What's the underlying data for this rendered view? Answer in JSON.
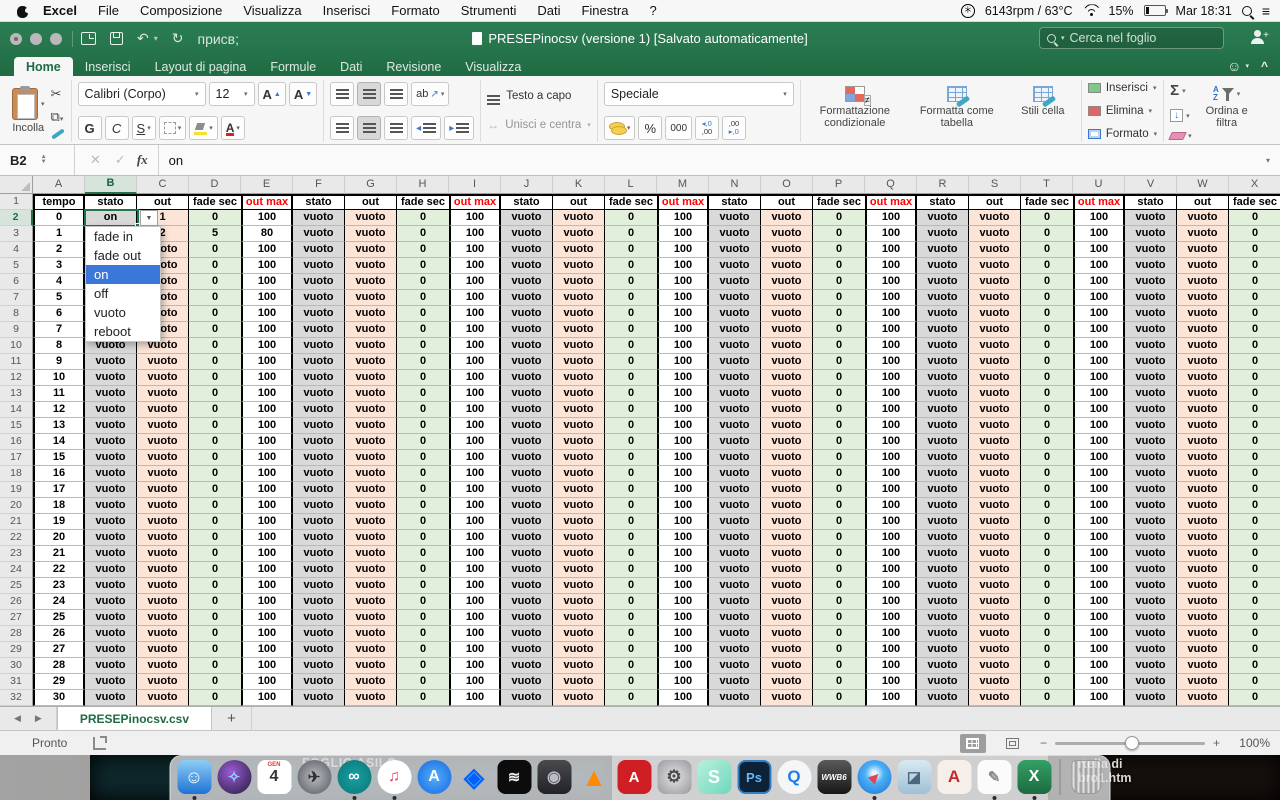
{
  "menubar": {
    "items": [
      "Excel",
      "File",
      "Composizione",
      "Visualizza",
      "Inserisci",
      "Formato",
      "Strumenti",
      "Dati",
      "Finestra",
      "?"
    ],
    "fan_text": "6143rpm / 63°C",
    "battery": "15%",
    "clock": "Mar 18:31"
  },
  "titlebar": {
    "title": "PRESEPinocsv (versione 1) [Salvato automaticamente]",
    "search_placeholder": "Cerca nel foglio"
  },
  "ribbon": {
    "tabs": [
      "Home",
      "Inserisci",
      "Layout di pagina",
      "Formule",
      "Dati",
      "Revisione",
      "Visualizza"
    ],
    "active_tab": "Home",
    "paste_label": "Incolla",
    "font_name": "Calibri (Corpo)",
    "font_size": "12",
    "grow_font": "A",
    "shrink_font": "A",
    "bold": "G",
    "italic": "C",
    "underline": "S",
    "orient": "ab",
    "orient_arrow": "↗",
    "wrap_label": "Testo a capo",
    "merge_label": "Unisci e centra",
    "number_format": "Speciale",
    "percent": "%",
    "thousands": "000",
    "dec1_top": "◂,0",
    "dec1_bot": ",00",
    "dec2_top": ",00",
    "dec2_bot": "▸,0",
    "cond_format": "Formattazione condizionale",
    "format_table": "Formatta come tabella",
    "cell_styles": "Stili cella",
    "insert_label": "Inserisci",
    "delete_label": "Elimina",
    "format_label": "Formato",
    "autosum": "Σ",
    "filldown": "↓",
    "az_a": "A",
    "az_z": "Z",
    "sort_filter": "Ordina e filtra"
  },
  "formula_bar": {
    "cell_ref": "B2",
    "fx_label": "fx",
    "value": "on",
    "cancel": "✕",
    "confirm": "✓"
  },
  "grid": {
    "selected_col": "B",
    "selected_row": 2,
    "column_letters": [
      "A",
      "B",
      "C",
      "D",
      "E",
      "F",
      "G",
      "H",
      "I",
      "J",
      "K",
      "L",
      "M",
      "N",
      "O",
      "P",
      "Q",
      "R",
      "S",
      "T",
      "U",
      "V",
      "W",
      "X"
    ],
    "header_row": [
      "tempo",
      "stato",
      "out",
      "fade sec",
      "out max",
      "stato",
      "out",
      "fade sec",
      "out max",
      "stato",
      "out",
      "fade sec",
      "out max",
      "stato",
      "out",
      "fade sec",
      "out max",
      "stato",
      "out",
      "fade sec",
      "out max",
      "stato",
      "out",
      "fade sec"
    ],
    "rows": [
      [
        "0",
        "on",
        "1",
        "0",
        "100",
        "vuoto",
        "vuoto",
        "0",
        "100",
        "vuoto",
        "vuoto",
        "0",
        "100",
        "vuoto",
        "vuoto",
        "0",
        "100",
        "vuoto",
        "vuoto",
        "0",
        "100",
        "vuoto",
        "vuoto",
        "0"
      ],
      [
        "1",
        "",
        "2",
        "5",
        "80",
        "vuoto",
        "vuoto",
        "0",
        "100",
        "vuoto",
        "vuoto",
        "0",
        "100",
        "vuoto",
        "vuoto",
        "0",
        "100",
        "vuoto",
        "vuoto",
        "0",
        "100",
        "vuoto",
        "vuoto",
        "0"
      ],
      [
        "2",
        "vuoto",
        "vuoto",
        "0",
        "100",
        "vuoto",
        "vuoto",
        "0",
        "100",
        "vuoto",
        "vuoto",
        "0",
        "100",
        "vuoto",
        "vuoto",
        "0",
        "100",
        "vuoto",
        "vuoto",
        "0",
        "100",
        "vuoto",
        "vuoto",
        "0"
      ],
      [
        "3",
        "vuoto",
        "vuoto",
        "0",
        "100",
        "vuoto",
        "vuoto",
        "0",
        "100",
        "vuoto",
        "vuoto",
        "0",
        "100",
        "vuoto",
        "vuoto",
        "0",
        "100",
        "vuoto",
        "vuoto",
        "0",
        "100",
        "vuoto",
        "vuoto",
        "0"
      ],
      [
        "4",
        "vuoto",
        "vuoto",
        "0",
        "100",
        "vuoto",
        "vuoto",
        "0",
        "100",
        "vuoto",
        "vuoto",
        "0",
        "100",
        "vuoto",
        "vuoto",
        "0",
        "100",
        "vuoto",
        "vuoto",
        "0",
        "100",
        "vuoto",
        "vuoto",
        "0"
      ],
      [
        "5",
        "vuoto",
        "vuoto",
        "0",
        "100",
        "vuoto",
        "vuoto",
        "0",
        "100",
        "vuoto",
        "vuoto",
        "0",
        "100",
        "vuoto",
        "vuoto",
        "0",
        "100",
        "vuoto",
        "vuoto",
        "0",
        "100",
        "vuoto",
        "vuoto",
        "0"
      ],
      [
        "6",
        "vuoto",
        "vuoto",
        "0",
        "100",
        "vuoto",
        "vuoto",
        "0",
        "100",
        "vuoto",
        "vuoto",
        "0",
        "100",
        "vuoto",
        "vuoto",
        "0",
        "100",
        "vuoto",
        "vuoto",
        "0",
        "100",
        "vuoto",
        "vuoto",
        "0"
      ],
      [
        "7",
        "vuoto",
        "vuoto",
        "0",
        "100",
        "vuoto",
        "vuoto",
        "0",
        "100",
        "vuoto",
        "vuoto",
        "0",
        "100",
        "vuoto",
        "vuoto",
        "0",
        "100",
        "vuoto",
        "vuoto",
        "0",
        "100",
        "vuoto",
        "vuoto",
        "0"
      ],
      [
        "8",
        "vuoto",
        "vuoto",
        "0",
        "100",
        "vuoto",
        "vuoto",
        "0",
        "100",
        "vuoto",
        "vuoto",
        "0",
        "100",
        "vuoto",
        "vuoto",
        "0",
        "100",
        "vuoto",
        "vuoto",
        "0",
        "100",
        "vuoto",
        "vuoto",
        "0"
      ],
      [
        "9",
        "vuoto",
        "vuoto",
        "0",
        "100",
        "vuoto",
        "vuoto",
        "0",
        "100",
        "vuoto",
        "vuoto",
        "0",
        "100",
        "vuoto",
        "vuoto",
        "0",
        "100",
        "vuoto",
        "vuoto",
        "0",
        "100",
        "vuoto",
        "vuoto",
        "0"
      ],
      [
        "10",
        "vuoto",
        "vuoto",
        "0",
        "100",
        "vuoto",
        "vuoto",
        "0",
        "100",
        "vuoto",
        "vuoto",
        "0",
        "100",
        "vuoto",
        "vuoto",
        "0",
        "100",
        "vuoto",
        "vuoto",
        "0",
        "100",
        "vuoto",
        "vuoto",
        "0"
      ],
      [
        "11",
        "vuoto",
        "vuoto",
        "0",
        "100",
        "vuoto",
        "vuoto",
        "0",
        "100",
        "vuoto",
        "vuoto",
        "0",
        "100",
        "vuoto",
        "vuoto",
        "0",
        "100",
        "vuoto",
        "vuoto",
        "0",
        "100",
        "vuoto",
        "vuoto",
        "0"
      ],
      [
        "12",
        "vuoto",
        "vuoto",
        "0",
        "100",
        "vuoto",
        "vuoto",
        "0",
        "100",
        "vuoto",
        "vuoto",
        "0",
        "100",
        "vuoto",
        "vuoto",
        "0",
        "100",
        "vuoto",
        "vuoto",
        "0",
        "100",
        "vuoto",
        "vuoto",
        "0"
      ],
      [
        "13",
        "vuoto",
        "vuoto",
        "0",
        "100",
        "vuoto",
        "vuoto",
        "0",
        "100",
        "vuoto",
        "vuoto",
        "0",
        "100",
        "vuoto",
        "vuoto",
        "0",
        "100",
        "vuoto",
        "vuoto",
        "0",
        "100",
        "vuoto",
        "vuoto",
        "0"
      ],
      [
        "14",
        "vuoto",
        "vuoto",
        "0",
        "100",
        "vuoto",
        "vuoto",
        "0",
        "100",
        "vuoto",
        "vuoto",
        "0",
        "100",
        "vuoto",
        "vuoto",
        "0",
        "100",
        "vuoto",
        "vuoto",
        "0",
        "100",
        "vuoto",
        "vuoto",
        "0"
      ],
      [
        "15",
        "vuoto",
        "vuoto",
        "0",
        "100",
        "vuoto",
        "vuoto",
        "0",
        "100",
        "vuoto",
        "vuoto",
        "0",
        "100",
        "vuoto",
        "vuoto",
        "0",
        "100",
        "vuoto",
        "vuoto",
        "0",
        "100",
        "vuoto",
        "vuoto",
        "0"
      ],
      [
        "16",
        "vuoto",
        "vuoto",
        "0",
        "100",
        "vuoto",
        "vuoto",
        "0",
        "100",
        "vuoto",
        "vuoto",
        "0",
        "100",
        "vuoto",
        "vuoto",
        "0",
        "100",
        "vuoto",
        "vuoto",
        "0",
        "100",
        "vuoto",
        "vuoto",
        "0"
      ],
      [
        "17",
        "vuoto",
        "vuoto",
        "0",
        "100",
        "vuoto",
        "vuoto",
        "0",
        "100",
        "vuoto",
        "vuoto",
        "0",
        "100",
        "vuoto",
        "vuoto",
        "0",
        "100",
        "vuoto",
        "vuoto",
        "0",
        "100",
        "vuoto",
        "vuoto",
        "0"
      ],
      [
        "18",
        "vuoto",
        "vuoto",
        "0",
        "100",
        "vuoto",
        "vuoto",
        "0",
        "100",
        "vuoto",
        "vuoto",
        "0",
        "100",
        "vuoto",
        "vuoto",
        "0",
        "100",
        "vuoto",
        "vuoto",
        "0",
        "100",
        "vuoto",
        "vuoto",
        "0"
      ],
      [
        "19",
        "vuoto",
        "vuoto",
        "0",
        "100",
        "vuoto",
        "vuoto",
        "0",
        "100",
        "vuoto",
        "vuoto",
        "0",
        "100",
        "vuoto",
        "vuoto",
        "0",
        "100",
        "vuoto",
        "vuoto",
        "0",
        "100",
        "vuoto",
        "vuoto",
        "0"
      ],
      [
        "20",
        "vuoto",
        "vuoto",
        "0",
        "100",
        "vuoto",
        "vuoto",
        "0",
        "100",
        "vuoto",
        "vuoto",
        "0",
        "100",
        "vuoto",
        "vuoto",
        "0",
        "100",
        "vuoto",
        "vuoto",
        "0",
        "100",
        "vuoto",
        "vuoto",
        "0"
      ],
      [
        "21",
        "vuoto",
        "vuoto",
        "0",
        "100",
        "vuoto",
        "vuoto",
        "0",
        "100",
        "vuoto",
        "vuoto",
        "0",
        "100",
        "vuoto",
        "vuoto",
        "0",
        "100",
        "vuoto",
        "vuoto",
        "0",
        "100",
        "vuoto",
        "vuoto",
        "0"
      ],
      [
        "22",
        "vuoto",
        "vuoto",
        "0",
        "100",
        "vuoto",
        "vuoto",
        "0",
        "100",
        "vuoto",
        "vuoto",
        "0",
        "100",
        "vuoto",
        "vuoto",
        "0",
        "100",
        "vuoto",
        "vuoto",
        "0",
        "100",
        "vuoto",
        "vuoto",
        "0"
      ],
      [
        "23",
        "vuoto",
        "vuoto",
        "0",
        "100",
        "vuoto",
        "vuoto",
        "0",
        "100",
        "vuoto",
        "vuoto",
        "0",
        "100",
        "vuoto",
        "vuoto",
        "0",
        "100",
        "vuoto",
        "vuoto",
        "0",
        "100",
        "vuoto",
        "vuoto",
        "0"
      ],
      [
        "24",
        "vuoto",
        "vuoto",
        "0",
        "100",
        "vuoto",
        "vuoto",
        "0",
        "100",
        "vuoto",
        "vuoto",
        "0",
        "100",
        "vuoto",
        "vuoto",
        "0",
        "100",
        "vuoto",
        "vuoto",
        "0",
        "100",
        "vuoto",
        "vuoto",
        "0"
      ],
      [
        "25",
        "vuoto",
        "vuoto",
        "0",
        "100",
        "vuoto",
        "vuoto",
        "0",
        "100",
        "vuoto",
        "vuoto",
        "0",
        "100",
        "vuoto",
        "vuoto",
        "0",
        "100",
        "vuoto",
        "vuoto",
        "0",
        "100",
        "vuoto",
        "vuoto",
        "0"
      ],
      [
        "26",
        "vuoto",
        "vuoto",
        "0",
        "100",
        "vuoto",
        "vuoto",
        "0",
        "100",
        "vuoto",
        "vuoto",
        "0",
        "100",
        "vuoto",
        "vuoto",
        "0",
        "100",
        "vuoto",
        "vuoto",
        "0",
        "100",
        "vuoto",
        "vuoto",
        "0"
      ],
      [
        "27",
        "vuoto",
        "vuoto",
        "0",
        "100",
        "vuoto",
        "vuoto",
        "0",
        "100",
        "vuoto",
        "vuoto",
        "0",
        "100",
        "vuoto",
        "vuoto",
        "0",
        "100",
        "vuoto",
        "vuoto",
        "0",
        "100",
        "vuoto",
        "vuoto",
        "0"
      ],
      [
        "28",
        "vuoto",
        "vuoto",
        "0",
        "100",
        "vuoto",
        "vuoto",
        "0",
        "100",
        "vuoto",
        "vuoto",
        "0",
        "100",
        "vuoto",
        "vuoto",
        "0",
        "100",
        "vuoto",
        "vuoto",
        "0",
        "100",
        "vuoto",
        "vuoto",
        "0"
      ],
      [
        "29",
        "vuoto",
        "vuoto",
        "0",
        "100",
        "vuoto",
        "vuoto",
        "0",
        "100",
        "vuoto",
        "vuoto",
        "0",
        "100",
        "vuoto",
        "vuoto",
        "0",
        "100",
        "vuoto",
        "vuoto",
        "0",
        "100",
        "vuoto",
        "vuoto",
        "0"
      ],
      [
        "30",
        "vuoto",
        "vuoto",
        "0",
        "100",
        "vuoto",
        "vuoto",
        "0",
        "100",
        "vuoto",
        "vuoto",
        "0",
        "100",
        "vuoto",
        "vuoto",
        "0",
        "100",
        "vuoto",
        "vuoto",
        "0",
        "100",
        "vuoto",
        "vuoto",
        "0"
      ]
    ]
  },
  "dropdown": {
    "options": [
      "fade in",
      "fade out",
      "on",
      "off",
      "vuoto",
      "reboot"
    ],
    "selected_index": 2
  },
  "sheetbar": {
    "active_tab": "PRESEPinocsv.csv",
    "add_label": "+"
  },
  "statusbar": {
    "ready": "Pronto",
    "zoom_pct": "100%",
    "minus": "−",
    "plus": "+"
  },
  "desktop": {
    "left_text": "FOGLIO ASILO",
    "right_line1": "rtella di",
    "right_line2": "bro1.htm"
  },
  "dock": {
    "items": [
      {
        "name": "finder",
        "glyph": "☺",
        "fg": "#ffffff",
        "bg": "linear-gradient(180deg,#8ecdf7,#1e72d4)",
        "round": false,
        "dot": true,
        "size": 18
      },
      {
        "name": "siri",
        "glyph": "✧",
        "fg": "#8fd0ff",
        "bg": "radial-gradient(circle at 40% 35%, #9a5bd4, #241b3a)",
        "round": true,
        "dot": false,
        "size": 15
      },
      {
        "name": "calendar",
        "glyph": "4",
        "fg": "#333333",
        "bg": "#ffffff",
        "round": false,
        "dot": false,
        "size": 16,
        "top": "GEN",
        "top_color": "#e03c31"
      },
      {
        "name": "launchpad",
        "glyph": "✈",
        "fg": "#2e3033",
        "bg": "radial-gradient(circle,#b9bdc2,#53565c)",
        "round": true,
        "dot": false,
        "size": 15
      },
      {
        "name": "arduino",
        "glyph": "∞",
        "fg": "#ffffff",
        "bg": "radial-gradient(circle,#17a0a3,#0c7476)",
        "round": true,
        "dot": true,
        "size": 16
      },
      {
        "name": "itunes",
        "glyph": "♫",
        "fg": "#f0426b",
        "bg": "#ffffff",
        "round": true,
        "dot": true,
        "size": 16
      },
      {
        "name": "app-store",
        "glyph": "A",
        "fg": "#ffffff",
        "bg": "radial-gradient(circle,#53aefc,#1667de)",
        "round": true,
        "dot": false,
        "size": 16
      },
      {
        "name": "dropbox",
        "glyph": "◈",
        "fg": "#0062ff",
        "bg": "transparent",
        "round": false,
        "dot": false,
        "size": 26
      },
      {
        "name": "photo-transfer",
        "glyph": "≋",
        "fg": "#eeeeee",
        "bg": "#0c0c0c",
        "round": false,
        "dot": false,
        "size": 15
      },
      {
        "name": "disc-burner",
        "glyph": "◉",
        "fg": "#b9bcc4",
        "bg": "linear-gradient(#4a4a4e,#232327)",
        "round": false,
        "dot": false,
        "size": 16
      },
      {
        "name": "vlc",
        "glyph": "▲",
        "fg": "#ff8a00",
        "bg": "transparent",
        "round": false,
        "dot": false,
        "size": 26
      },
      {
        "name": "acrobat",
        "glyph": "A",
        "fg": "#ffffff",
        "bg": "#cf1f25",
        "round": false,
        "dot": false,
        "size": 15
      },
      {
        "name": "system-preferences",
        "glyph": "⚙",
        "fg": "#4a4a4e",
        "bg": "radial-gradient(#e3e3e5,#97989c)",
        "round": false,
        "dot": false,
        "size": 17
      },
      {
        "name": "sublime-s",
        "glyph": "S",
        "fg": "#ffffff",
        "bg": "linear-gradient(135deg,#b7f0dc,#6fd7bd)",
        "round": false,
        "dot": false,
        "size": 18
      },
      {
        "name": "photoshop",
        "glyph": "Ps",
        "fg": "#66b8f5",
        "bg": "#0d2237",
        "round": false,
        "dot": false,
        "size": 13,
        "border": "#2f81c4"
      },
      {
        "name": "quicktime",
        "glyph": "Q",
        "fg": "#1a7cf0",
        "bg": "#f5f6f8",
        "round": true,
        "dot": false,
        "size": 17
      },
      {
        "name": "wwb6",
        "glyph": "WWB6",
        "fg": "#ffffff",
        "bg": "linear-gradient(#5a5a5a,#161616)",
        "round": false,
        "dot": false,
        "size": 8
      },
      {
        "name": "safari",
        "glyph": "▶",
        "fg": "#e8434a",
        "bg": "radial-gradient(circle at 50% 40%, #eaf6ff 8%, #4cb1f7 35%, #1c6fd2 100%)",
        "round": true,
        "dot": true,
        "size": 12,
        "rotate": -45
      },
      {
        "name": "preview",
        "glyph": "◪",
        "fg": "#48677e",
        "bg": "linear-gradient(#d8e9f2,#9fc0d4)",
        "round": false,
        "dot": false,
        "size": 15
      },
      {
        "name": "autocad",
        "glyph": "A",
        "fg": "#c22a2f",
        "bg": "#f6efe9",
        "round": false,
        "dot": false,
        "size": 17
      },
      {
        "name": "textedit",
        "glyph": "✎",
        "fg": "#8a8a8a",
        "bg": "#fbfbfb",
        "round": false,
        "dot": true,
        "size": 15
      },
      {
        "name": "excel",
        "glyph": "X",
        "fg": "#ffffff",
        "bg": "linear-gradient(#35a065,#1c6b41)",
        "round": false,
        "dot": true,
        "size": 16
      },
      {
        "name": "trash",
        "glyph": "",
        "fg": "#888888",
        "bg": "",
        "round": false,
        "dot": false,
        "size": 0,
        "divider": true,
        "trash": true
      }
    ]
  }
}
